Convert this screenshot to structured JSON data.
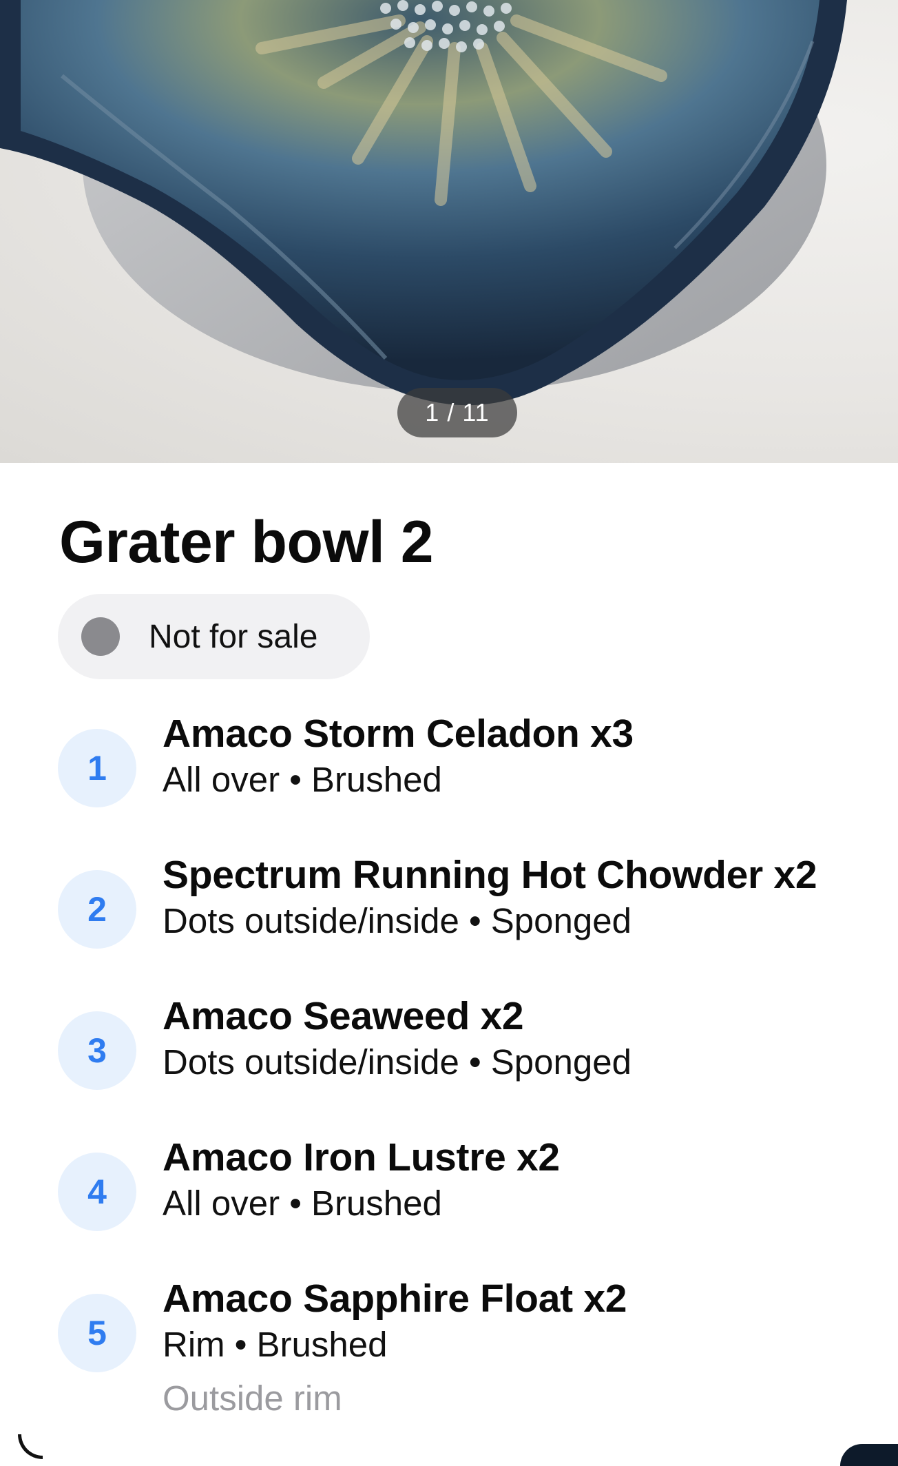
{
  "photo": {
    "counter": "1 / 11",
    "current": 1,
    "total": 11
  },
  "piece": {
    "title": "Grater bowl 2",
    "status": "Not for sale",
    "status_color": "#8a8a8e"
  },
  "glazes": [
    {
      "number": "1",
      "name": "Amaco Storm Celadon x3",
      "area": "All over",
      "method": "Brushed",
      "note": ""
    },
    {
      "number": "2",
      "name": "Spectrum Running Hot Chowder x2",
      "area": "Dots outside/inside",
      "method": "Sponged",
      "note": ""
    },
    {
      "number": "3",
      "name": "Amaco Seaweed x2",
      "area": "Dots outside/inside",
      "method": "Sponged",
      "note": ""
    },
    {
      "number": "4",
      "name": "Amaco Iron Lustre x2",
      "area": "All over",
      "method": "Brushed",
      "note": ""
    },
    {
      "number": "5",
      "name": "Amaco Sapphire Float x2",
      "area": "Rim",
      "method": "Brushed",
      "note": "Outside rim"
    }
  ],
  "separator": "•",
  "colors": {
    "accent": "#2f7cf0",
    "accent_bg": "#e7f1fd",
    "badge_bg": "#f1f1f3",
    "muted_text": "#9b9b9f"
  }
}
